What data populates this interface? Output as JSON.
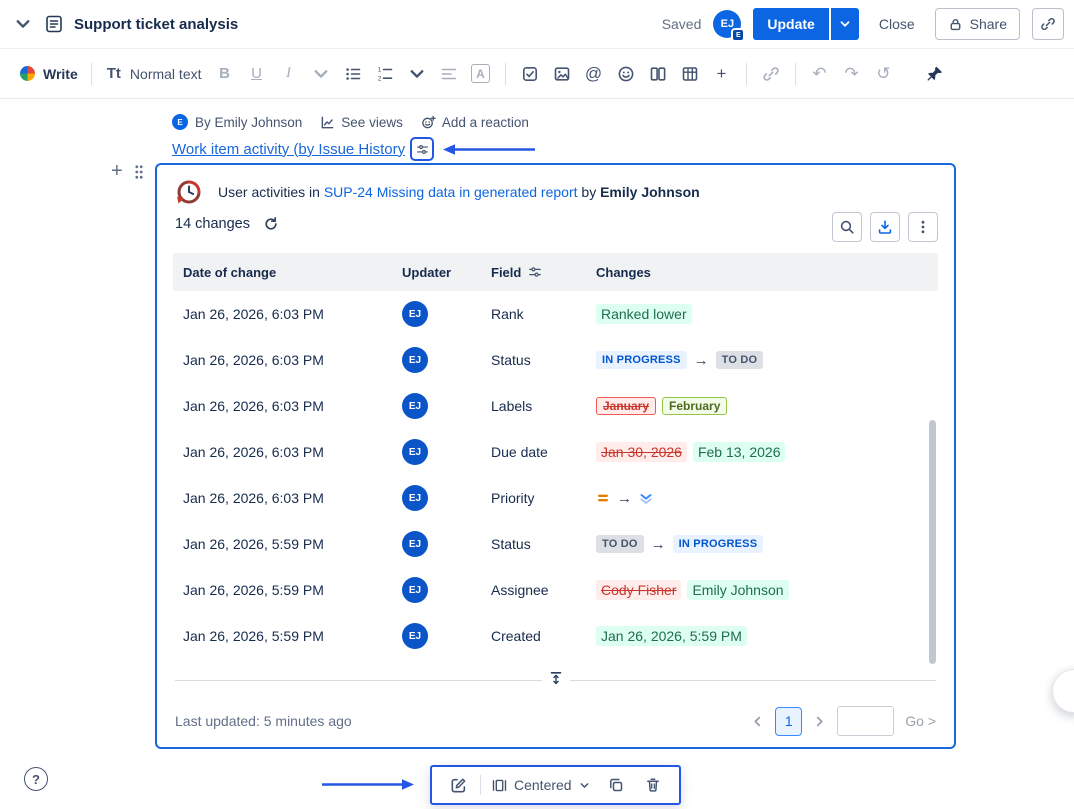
{
  "colors": {
    "accent_blue": "#0C66E4",
    "selection_blue": "#1868DB",
    "annotation_blue": "#2458E4",
    "added_bg": "#DCFFF1",
    "added_text": "#216E4E",
    "removed_bg": "#FFECEB",
    "removed_text": "#C9372C",
    "badge_inprogress_bg": "#E9F2FF",
    "badge_inprogress_text": "#0055CC",
    "badge_todo_bg": "#DCDFE4",
    "badge_todo_text": "#44546F",
    "label_added_border": "#94C748",
    "label_removed_border": "#F15B50",
    "priority_medium_orange": "#E77D00",
    "priority_lowest_blue": "#388BFF"
  },
  "icons": {
    "arrow": "→",
    "undo": "↶",
    "redo": "↷",
    "history": "↺",
    "plus": "+",
    "mention": "@",
    "help": "?"
  },
  "topbar": {
    "title": "Support ticket analysis",
    "saved_label": "Saved",
    "avatar_initials": "EJ",
    "avatar_badge": "E",
    "update_label": "Update",
    "close_label": "Close",
    "share_label": "Share"
  },
  "toolbar": {
    "write_label": "Write",
    "text_style_icon": "Tt",
    "text_style_label": "Normal text",
    "bold_label": "B",
    "underline_label": "U",
    "italic_label": "I",
    "text_color_label": "A"
  },
  "byline": {
    "avatar_initial": "E",
    "author": "By Emily Johnson",
    "see_views": "See views",
    "add_reaction": "Add a reaction"
  },
  "macro_link": {
    "text": "Work item activity (by Issue History"
  },
  "card": {
    "title_prefix": "User activities in",
    "issue_link": "SUP-24 Missing data in generated report",
    "by_label": "by",
    "author": "Emily Johnson",
    "changes_count": "14 changes",
    "table": {
      "headers": [
        "Date of change",
        "Updater",
        "Field",
        "Changes"
      ],
      "rows": [
        {
          "date": "Jan 26, 2026, 6:03 PM",
          "updater": "EJ",
          "field": "Rank",
          "changes": [
            {
              "type": "added",
              "text": "Ranked lower"
            }
          ]
        },
        {
          "date": "Jan 26, 2026, 6:03 PM",
          "updater": "EJ",
          "field": "Status",
          "changes": [
            {
              "type": "badge-inprogress",
              "text": "IN PROGRESS"
            },
            {
              "type": "arrow"
            },
            {
              "type": "badge-todo",
              "text": "TO DO"
            }
          ]
        },
        {
          "date": "Jan 26, 2026, 6:03 PM",
          "updater": "EJ",
          "field": "Labels",
          "changes": [
            {
              "type": "label-removed",
              "text": "January"
            },
            {
              "type": "label-added",
              "text": "February"
            }
          ]
        },
        {
          "date": "Jan 26, 2026, 6:03 PM",
          "updater": "EJ",
          "field": "Due date",
          "changes": [
            {
              "type": "removed",
              "text": "Jan 30, 2026"
            },
            {
              "type": "added",
              "text": "Feb 13, 2026"
            }
          ]
        },
        {
          "date": "Jan 26, 2026, 6:03 PM",
          "updater": "EJ",
          "field": "Priority",
          "changes": [
            {
              "type": "icon",
              "name": "priority-medium"
            },
            {
              "type": "arrow"
            },
            {
              "type": "icon",
              "name": "priority-lowest"
            }
          ]
        },
        {
          "date": "Jan 26, 2026, 5:59 PM",
          "updater": "EJ",
          "field": "Status",
          "changes": [
            {
              "type": "badge-todo",
              "text": "TO DO"
            },
            {
              "type": "arrow"
            },
            {
              "type": "badge-inprogress",
              "text": "IN PROGRESS"
            }
          ]
        },
        {
          "date": "Jan 26, 2026, 5:59 PM",
          "updater": "EJ",
          "field": "Assignee",
          "changes": [
            {
              "type": "removed",
              "text": "Cody Fisher"
            },
            {
              "type": "added",
              "text": "Emily Johnson"
            }
          ]
        },
        {
          "date": "Jan 26, 2026, 5:59 PM",
          "updater": "EJ",
          "field": "Created",
          "changes": [
            {
              "type": "added",
              "text": "Jan 26, 2026, 5:59 PM"
            }
          ]
        }
      ]
    },
    "footer": {
      "last_updated": "Last updated: 5 minutes ago",
      "page_number": "1",
      "page_input_value": "",
      "go_label": "Go >"
    }
  },
  "floating_toolbar": {
    "layout_label": "Centered"
  }
}
